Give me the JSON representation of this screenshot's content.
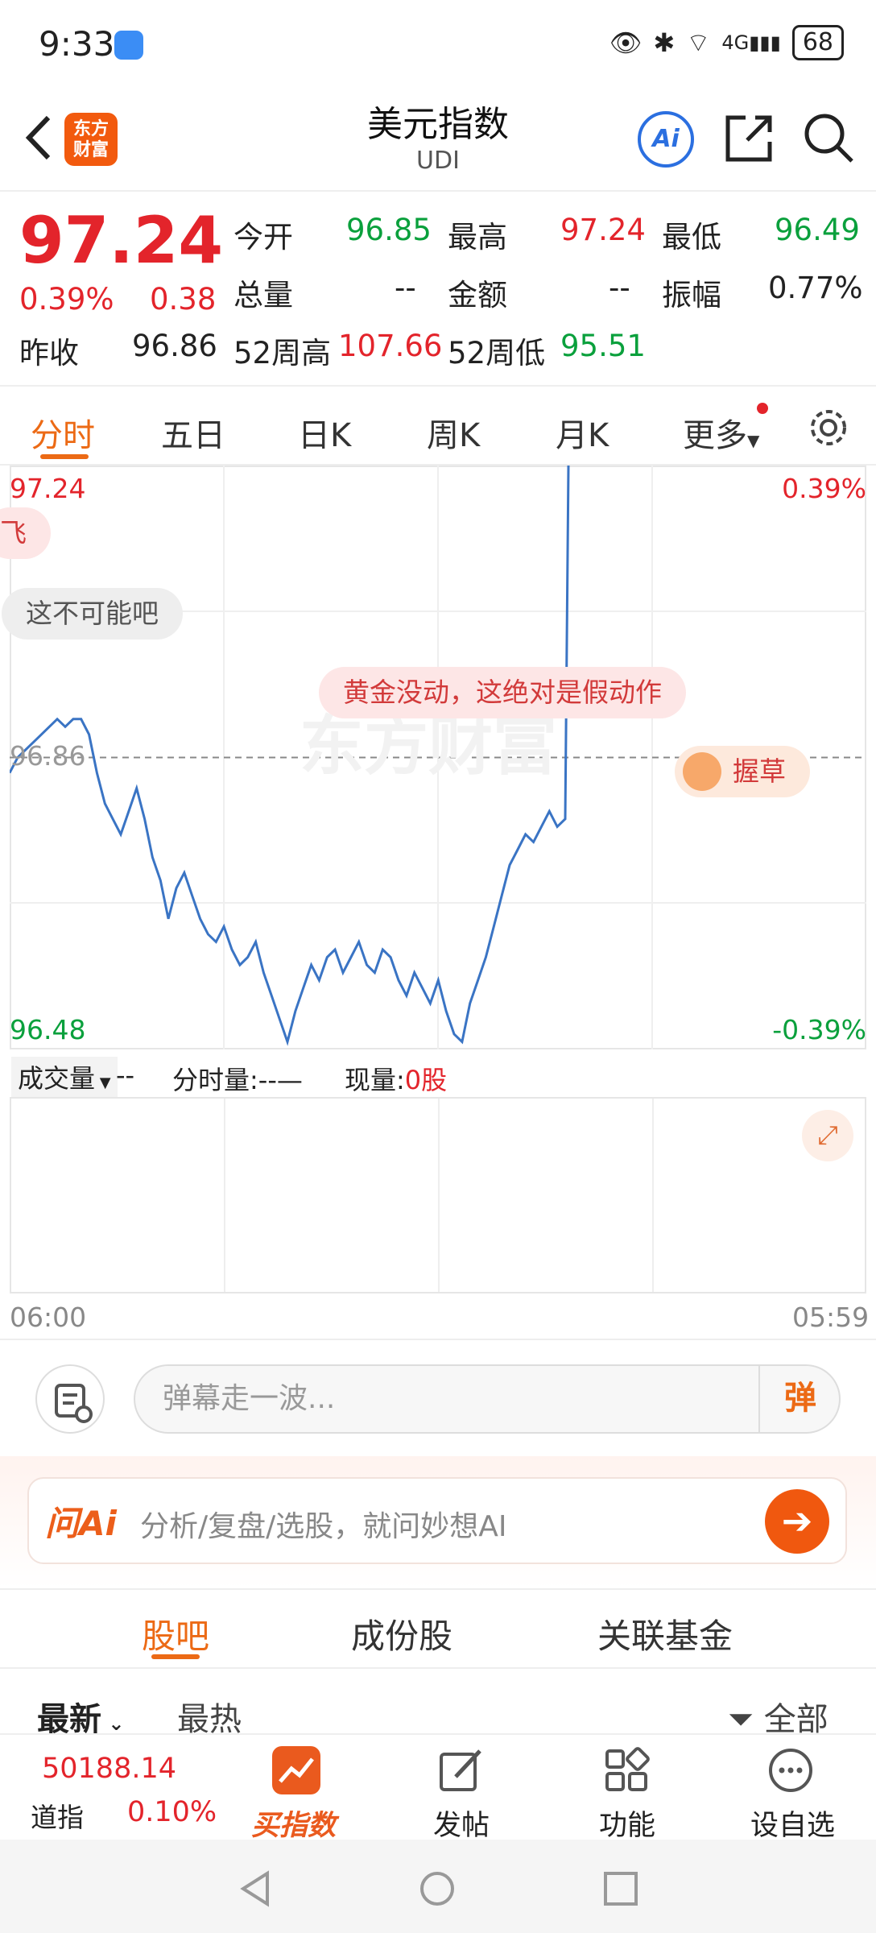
{
  "status": {
    "time": "9:33",
    "signal": "4G",
    "battery": "68"
  },
  "header": {
    "title": "美元指数",
    "subtitle": "UDI",
    "logo_line1": "东方",
    "logo_line2": "财富",
    "ai_label": "Ai"
  },
  "quote": {
    "price": "97.24",
    "change_pct": "0.39%",
    "change": "0.38",
    "prev_close_label": "昨收",
    "prev_close": "96.86",
    "open_label": "今开",
    "open": "96.85",
    "high_label": "最高",
    "high": "97.24",
    "low_label": "最低",
    "low": "96.49",
    "volume_label": "总量",
    "volume": "--",
    "amount_label": "金额",
    "amount": "--",
    "amplitude_label": "振幅",
    "amplitude": "0.77%",
    "w52_high_label": "52周高",
    "w52_high": "107.66",
    "w52_low_label": "52周低",
    "w52_low": "95.51"
  },
  "tabs": [
    "分时",
    "五日",
    "日K",
    "周K",
    "月K",
    "更多"
  ],
  "chart_data": {
    "type": "line",
    "y_top_label": "97.24",
    "y_mid_label": "96.86",
    "y_bottom_label": "96.48",
    "pct_top": "0.39%",
    "pct_bottom": "-0.39%",
    "x_start": "06:00",
    "x_end": "05:59",
    "ylim": [
      96.48,
      97.24
    ],
    "reference": 96.86,
    "y": [
      96.84,
      96.86,
      96.87,
      96.88,
      96.89,
      96.9,
      96.91,
      96.9,
      96.91,
      96.91,
      96.89,
      96.84,
      96.8,
      96.78,
      96.76,
      96.79,
      96.82,
      96.78,
      96.73,
      96.7,
      96.65,
      96.69,
      96.71,
      96.68,
      96.65,
      96.63,
      96.62,
      96.64,
      96.61,
      96.59,
      96.6,
      96.62,
      96.58,
      96.55,
      96.52,
      96.49,
      96.53,
      96.56,
      96.59,
      96.57,
      96.6,
      96.61,
      96.58,
      96.6,
      96.62,
      96.59,
      96.58,
      96.61,
      96.6,
      96.57,
      96.55,
      96.58,
      96.56,
      96.54,
      96.57,
      96.53,
      96.5,
      96.49,
      96.54,
      96.57,
      96.6,
      96.64,
      96.68,
      96.72,
      96.74,
      96.76,
      96.75,
      96.77,
      96.79,
      96.77,
      96.78,
      97.24
    ],
    "colors": {
      "line": "#3a74c4",
      "up": "#e3242b",
      "down": "#0aa03c"
    }
  },
  "danmu": [
    "飞",
    "这不可能吧",
    "黄金没动，这绝对是假动作",
    "握草"
  ],
  "watermark": "东方财富",
  "volume_bar": {
    "select": "成交量",
    "dash": "--",
    "tick_label": "分时量:",
    "tick_value": "--—",
    "now_label": "现量:",
    "now_value": "0股"
  },
  "danmu_input": {
    "placeholder": "弹幕走一波...",
    "send": "弹"
  },
  "ai_search": {
    "logo": "问Ai",
    "placeholder": "分析/复盘/选股，就问妙想AI"
  },
  "bottom_tabs": [
    "股吧",
    "成份股",
    "关联基金"
  ],
  "filters": {
    "latest": "最新",
    "hottest": "最热",
    "all": "全部"
  },
  "nav": {
    "index_value": "50188.14",
    "index_name": "道指",
    "index_pct": "0.10%",
    "buy": "买指数",
    "post": "发帖",
    "func": "功能",
    "watch": "设自选"
  }
}
